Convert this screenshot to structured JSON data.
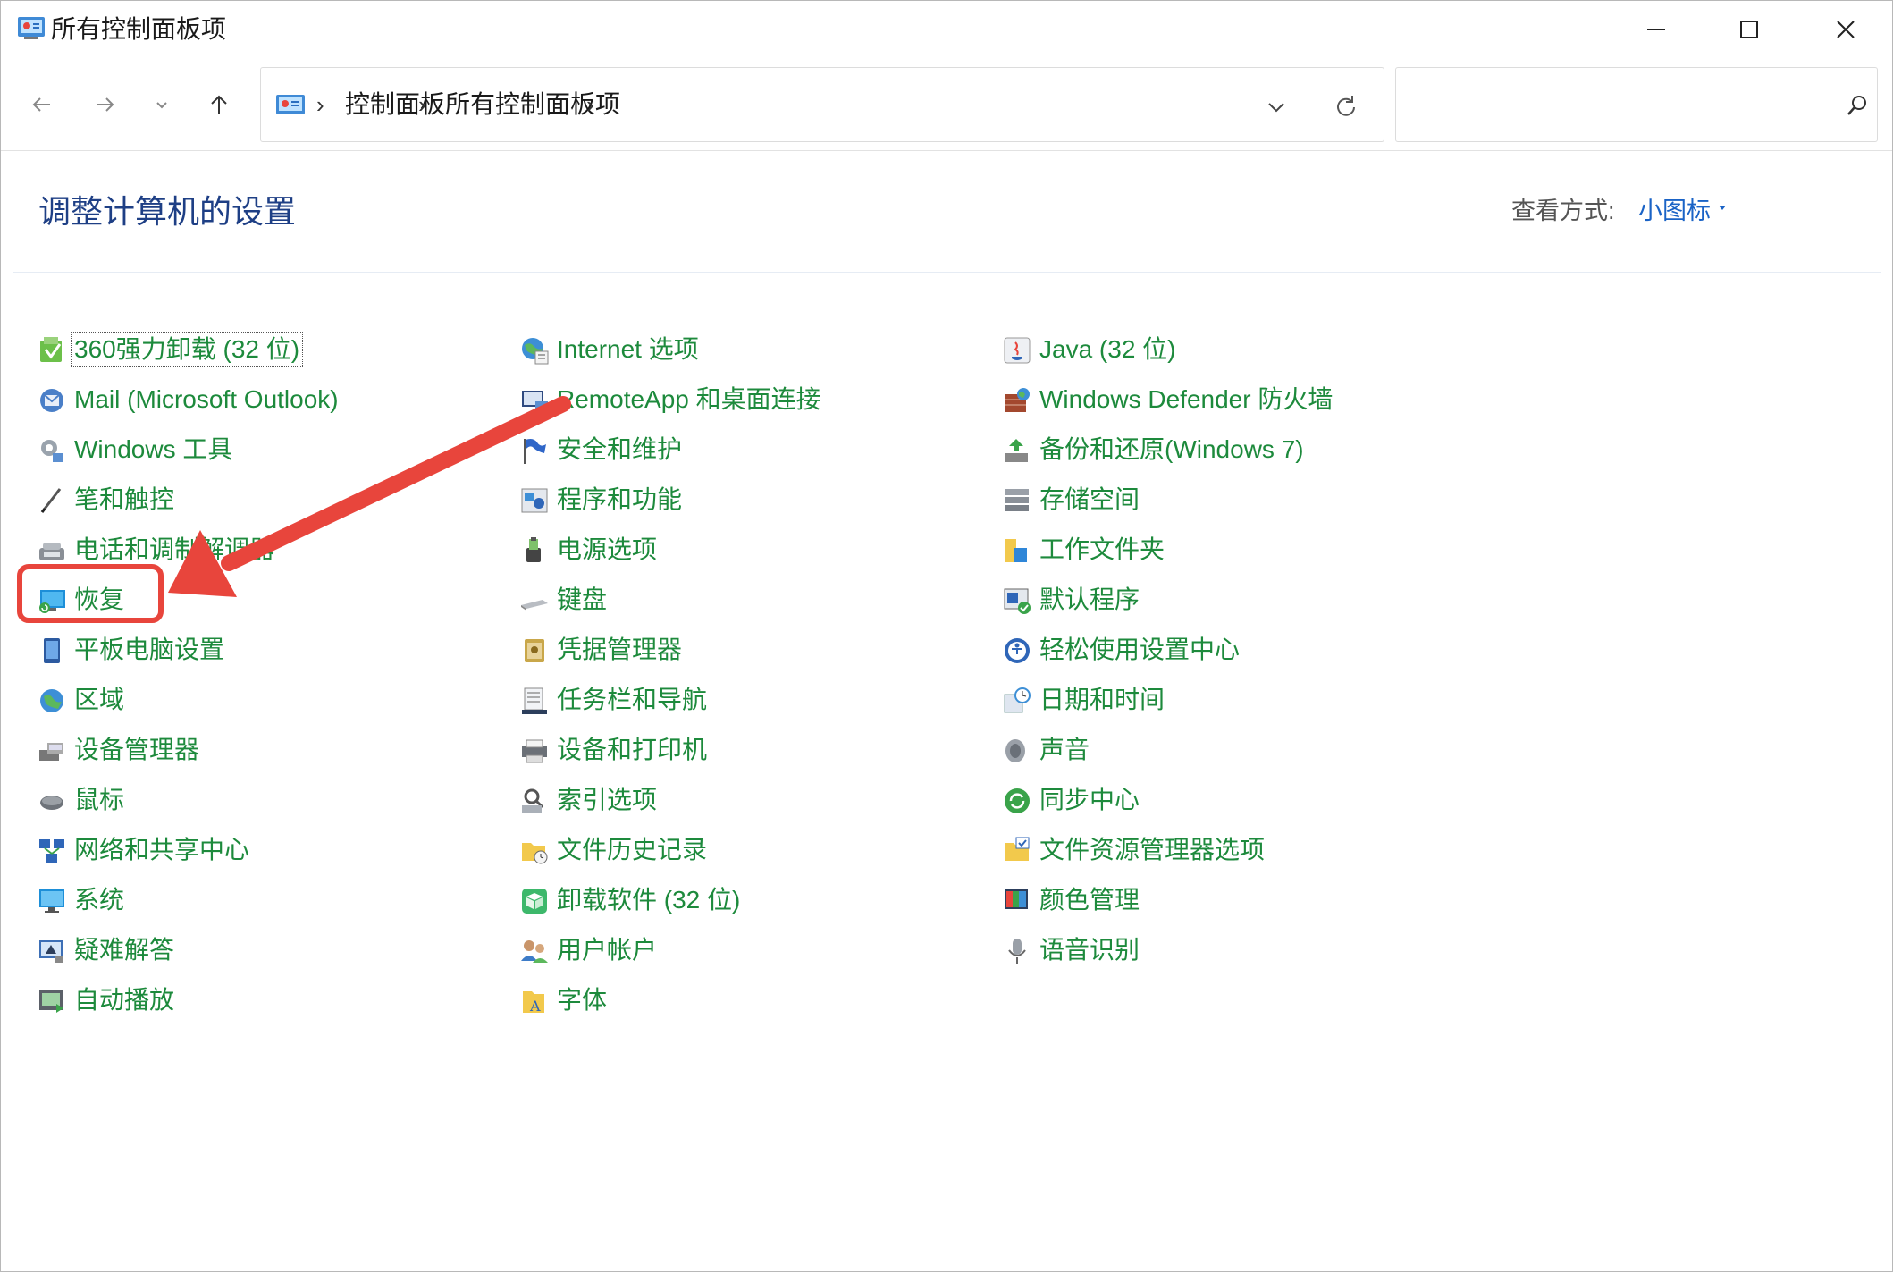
{
  "window": {
    "title": "所有控制面板项"
  },
  "nav": {
    "breadcrumb": [
      "控制面板",
      "所有控制面板项"
    ],
    "search_placeholder": ""
  },
  "header": {
    "title": "调整计算机的设置",
    "view_label": "查看方式:",
    "view_value": "小图标"
  },
  "columns": [
    {
      "items": [
        {
          "label": "360强力卸载 (32 位)",
          "icon": "uninstaller-icon",
          "focused": true
        },
        {
          "label": "Mail (Microsoft Outlook)",
          "icon": "mail-icon"
        },
        {
          "label": "Windows 工具",
          "icon": "gear-icon"
        },
        {
          "label": "笔和触控",
          "icon": "pen-icon"
        },
        {
          "label": "电话和调制解调器",
          "icon": "phone-modem-icon"
        },
        {
          "label": "恢复",
          "icon": "recovery-icon"
        },
        {
          "label": "平板电脑设置",
          "icon": "tablet-icon"
        },
        {
          "label": "区域",
          "icon": "globe-icon"
        },
        {
          "label": "设备管理器",
          "icon": "device-manager-icon"
        },
        {
          "label": "鼠标",
          "icon": "mouse-icon"
        },
        {
          "label": "网络和共享中心",
          "icon": "network-icon"
        },
        {
          "label": "系统",
          "icon": "monitor-icon"
        },
        {
          "label": "疑难解答",
          "icon": "troubleshoot-icon"
        },
        {
          "label": "自动播放",
          "icon": "autoplay-icon"
        }
      ]
    },
    {
      "items": [
        {
          "label": "Internet 选项",
          "icon": "internet-options-icon"
        },
        {
          "label": "RemoteApp 和桌面连接",
          "icon": "remoteapp-icon"
        },
        {
          "label": "安全和维护",
          "icon": "flag-icon"
        },
        {
          "label": "程序和功能",
          "icon": "programs-icon"
        },
        {
          "label": "电源选项",
          "icon": "power-icon"
        },
        {
          "label": "键盘",
          "icon": "keyboard-icon"
        },
        {
          "label": "凭据管理器",
          "icon": "credential-icon"
        },
        {
          "label": "任务栏和导航",
          "icon": "taskbar-icon"
        },
        {
          "label": "设备和打印机",
          "icon": "printer-icon"
        },
        {
          "label": "索引选项",
          "icon": "index-icon"
        },
        {
          "label": "文件历史记录",
          "icon": "file-history-icon"
        },
        {
          "label": "卸载软件 (32 位)",
          "icon": "package-icon"
        },
        {
          "label": "用户帐户",
          "icon": "users-icon"
        },
        {
          "label": "字体",
          "icon": "font-folder-icon"
        }
      ]
    },
    {
      "items": [
        {
          "label": "Java (32 位)",
          "icon": "java-icon"
        },
        {
          "label": "Windows Defender 防火墙",
          "icon": "firewall-icon"
        },
        {
          "label": "备份和还原(Windows 7)",
          "icon": "backup-icon"
        },
        {
          "label": "存储空间",
          "icon": "storage-icon"
        },
        {
          "label": "工作文件夹",
          "icon": "work-folder-icon"
        },
        {
          "label": "默认程序",
          "icon": "default-programs-icon"
        },
        {
          "label": "轻松使用设置中心",
          "icon": "ease-of-access-icon"
        },
        {
          "label": "日期和时间",
          "icon": "clock-icon"
        },
        {
          "label": "声音",
          "icon": "speaker-icon"
        },
        {
          "label": "同步中心",
          "icon": "sync-icon"
        },
        {
          "label": "文件资源管理器选项",
          "icon": "folder-options-icon"
        },
        {
          "label": "颜色管理",
          "icon": "color-management-icon"
        },
        {
          "label": "语音识别",
          "icon": "microphone-icon"
        }
      ]
    }
  ],
  "colors": {
    "link_green": "#1d8a3c",
    "title_blue": "#1e3f85",
    "view_blue": "#1a63c6",
    "annotation_red": "#e8453c"
  }
}
